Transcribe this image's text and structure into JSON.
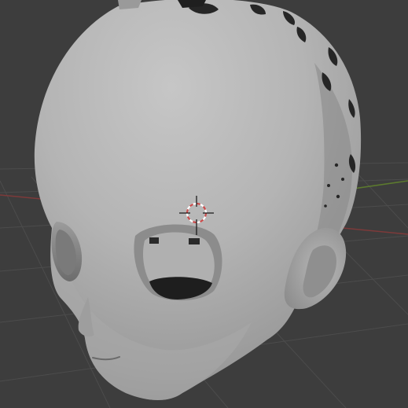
{
  "app": {
    "name": "",
    "view": "3d-viewport"
  },
  "viewport": {
    "background_color": "#3d3d3d",
    "grid_line_color": "#505050",
    "x_axis_color": "#8a3b3b",
    "y_axis_color": "#5c7a2e",
    "model_base_color": "#b5b5b5",
    "model_shadow_color": "#7a7a7a",
    "socket_inner_color": "#1e1e1e",
    "cursor_ring_color_a": "#c84b4b",
    "cursor_ring_color_b": "#ffffff",
    "cursor_line_color": "#111111"
  },
  "scene": {
    "object_type": "sculpted-head",
    "shading": "solid",
    "visible_features": [
      "head",
      "ear",
      "eye-socket",
      "nose",
      "mouth",
      "ventilation-holes"
    ],
    "cursor_icon": "3d-cursor-icon"
  }
}
